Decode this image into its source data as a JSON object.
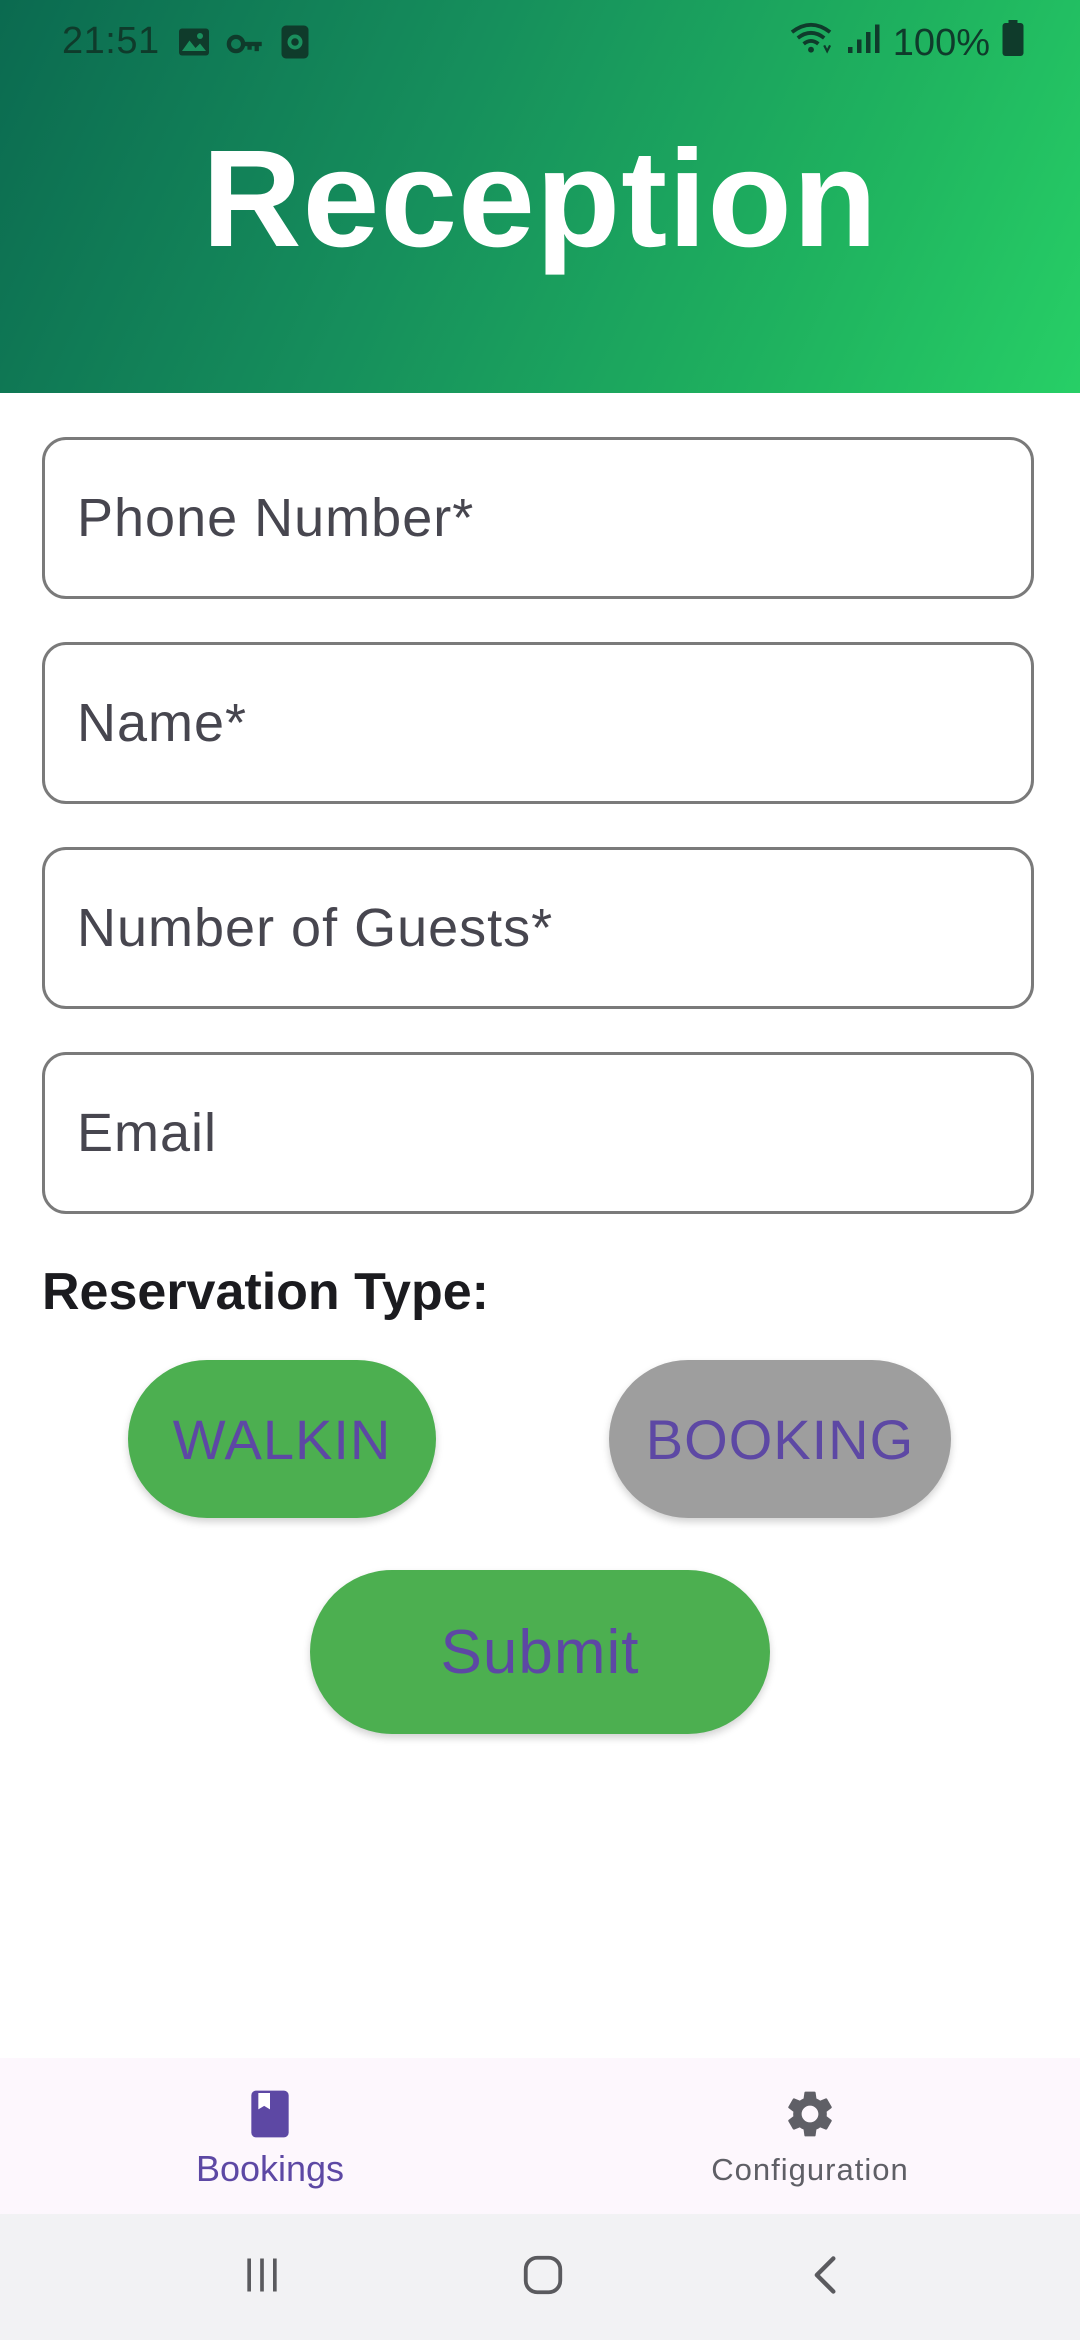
{
  "status_bar": {
    "time": "21:51",
    "battery_percent": "100%",
    "left_icons": [
      "image-icon",
      "key-icon",
      "screen-record-icon"
    ],
    "right_icons": [
      "wifi-icon",
      "signal-icon",
      "battery-icon"
    ]
  },
  "header": {
    "title": "Reception",
    "gradient_colors": [
      "#0b6a50",
      "#27cf66"
    ]
  },
  "form": {
    "phone_placeholder": "Phone Number*",
    "name_placeholder": "Name*",
    "guests_placeholder": "Number of Guests*",
    "email_placeholder": "Email",
    "phone_value": "",
    "name_value": "",
    "guests_value": "",
    "email_value": ""
  },
  "reservation": {
    "label": "Reservation Type:",
    "options": [
      {
        "label": "WALKIN",
        "selected": true,
        "color": "#4caf50"
      },
      {
        "label": "BOOKING",
        "selected": false,
        "color": "#9e9e9e"
      }
    ]
  },
  "submit": {
    "label": "Submit",
    "color": "#4caf50"
  },
  "bottom_nav": {
    "items": [
      {
        "label": "Bookings",
        "icon": "book-icon",
        "active": true
      },
      {
        "label": "Configuration",
        "icon": "gear-icon",
        "active": false
      }
    ],
    "active_color": "#5d48a4",
    "inactive_color": "#5f5f66"
  },
  "system_nav": {
    "buttons": [
      "recent-apps-icon",
      "home-icon",
      "back-icon"
    ]
  },
  "colors": {
    "label_text": "#5d48a4",
    "nav_bg": "#fdf7fd"
  }
}
